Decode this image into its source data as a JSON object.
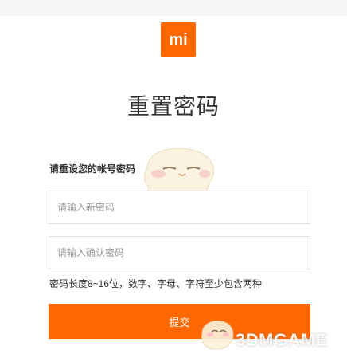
{
  "brand": {
    "logo_text": "mi",
    "accent": "#ff6700"
  },
  "page": {
    "title": "重置密码"
  },
  "form": {
    "subtitle": "请重设您的帐号密码",
    "new_password_placeholder": "请输入新密码",
    "confirm_password_placeholder": "请输入确认密码",
    "hint": "密码长度8~16位，数字、字母、字符至少包含两种",
    "submit_label": "提交"
  },
  "watermark": {
    "text": "3DMGAME",
    "icon": "mascot-logo-icon"
  }
}
